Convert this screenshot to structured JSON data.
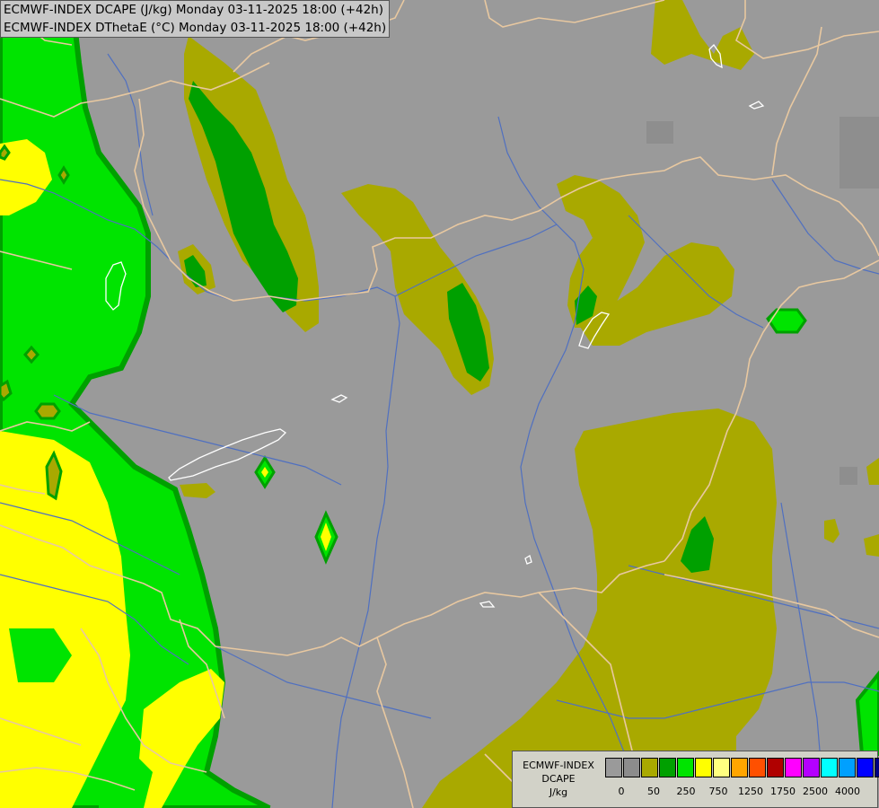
{
  "header": {
    "line1": "ECMWF-INDEX DCAPE (J/kg) Monday 03-11-2025 18:00 (+42h)",
    "line2": "ECMWF-INDEX DThetaE (°C) Monday 03-11-2025 18:00 (+42h)"
  },
  "legend": {
    "title_line1": "ECMWF-INDEX",
    "title_line2": "DCAPE",
    "unit": "J/kg",
    "colors": [
      "#9a9a9a",
      "#8c8c8c",
      "#a9a900",
      "#00a000",
      "#00e400",
      "#ffff00",
      "#ffff80",
      "#ffa500",
      "#ff5000",
      "#b00000",
      "#ff00ff",
      "#b400ff",
      "#00ffff",
      "#00a0ff",
      "#0000ff",
      "#000080"
    ],
    "ticks": [
      "0",
      "50",
      "250",
      "750",
      "1250",
      "1750",
      "2500",
      "4000"
    ]
  },
  "map": {
    "colors": {
      "background": "#9a9a9a",
      "olive": "#a9a900",
      "dark_green": "#00a000",
      "light_green": "#00e400",
      "yellow": "#ffff00",
      "borders": "#e8c8a0",
      "rivers": "#5070c0",
      "lakes": "#ffffff"
    }
  }
}
